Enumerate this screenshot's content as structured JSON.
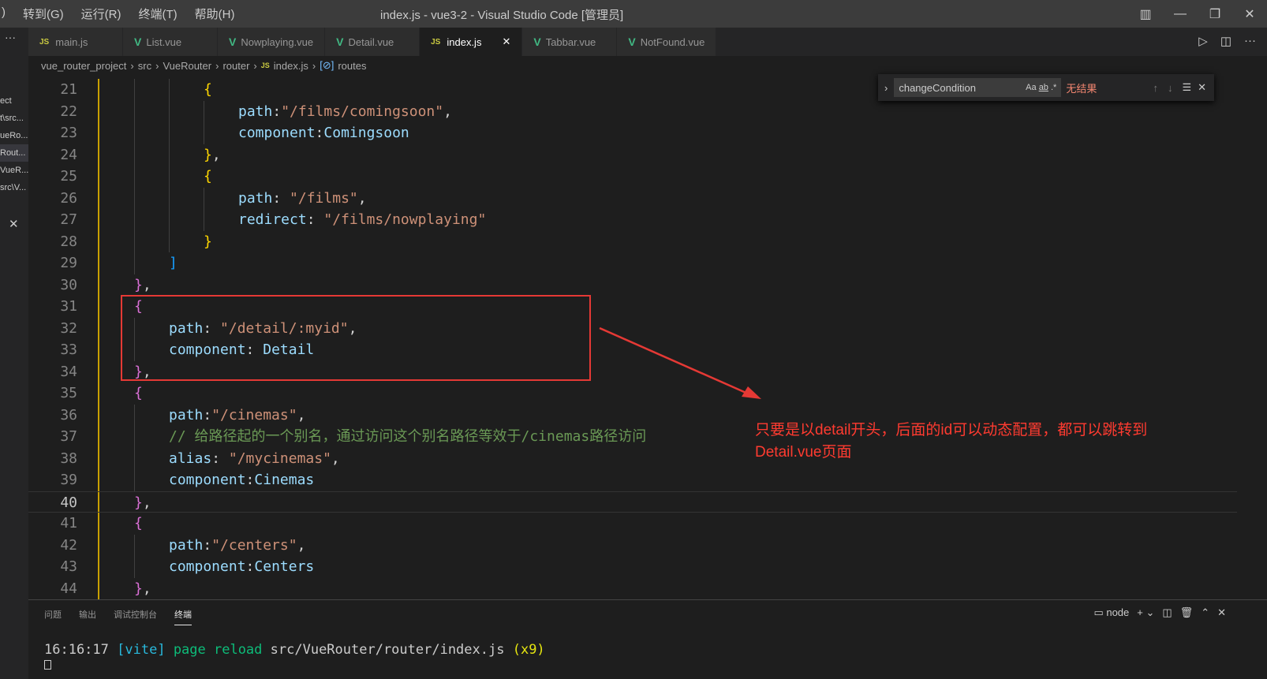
{
  "titlebar": {
    "menu": [
      ")",
      "转到(G)",
      "运行(R)",
      "终端(T)",
      "帮助(H)"
    ],
    "title": "index.js - vue3-2 - Visual Studio Code [管理员]"
  },
  "sidebar": {
    "items": [
      "ect",
      "t\\src...",
      "ueRo...",
      "Rout...",
      "VueR...",
      "src\\V..."
    ]
  },
  "tabs": [
    {
      "label": "main.js",
      "type": "js"
    },
    {
      "label": "List.vue",
      "type": "vue"
    },
    {
      "label": "Nowplaying.vue",
      "type": "vue"
    },
    {
      "label": "Detail.vue",
      "type": "vue"
    },
    {
      "label": "index.js",
      "type": "js",
      "active": true
    },
    {
      "label": "Tabbar.vue",
      "type": "vue"
    },
    {
      "label": "NotFound.vue",
      "type": "vue"
    }
  ],
  "breadcrumb": [
    "vue_router_project",
    "src",
    "VueRouter",
    "router",
    "index.js",
    "routes"
  ],
  "find": {
    "value": "changeCondition",
    "status": "无结果",
    "opts": [
      "Aa",
      "ab",
      ".*"
    ]
  },
  "code": [
    {
      "n": "21",
      "i": 12,
      "t": [
        [
          "b2",
          "{"
        ]
      ]
    },
    {
      "n": "22",
      "i": 16,
      "t": [
        [
          "k",
          "path"
        ],
        [
          "p",
          ":"
        ],
        [
          "s",
          "\"/films/comingsoon\""
        ],
        [
          "p",
          ","
        ]
      ]
    },
    {
      "n": "23",
      "i": 16,
      "t": [
        [
          "k",
          "component"
        ],
        [
          "p",
          ":"
        ],
        [
          "id",
          "Comingsoon"
        ]
      ]
    },
    {
      "n": "24",
      "i": 12,
      "t": [
        [
          "b2",
          "}"
        ],
        [
          "p",
          ","
        ]
      ]
    },
    {
      "n": "25",
      "i": 12,
      "t": [
        [
          "b2",
          "{"
        ]
      ]
    },
    {
      "n": "26",
      "i": 16,
      "t": [
        [
          "k",
          "path"
        ],
        [
          "p",
          ": "
        ],
        [
          "s",
          "\"/films\""
        ],
        [
          "p",
          ","
        ]
      ]
    },
    {
      "n": "27",
      "i": 16,
      "t": [
        [
          "k",
          "redirect"
        ],
        [
          "p",
          ": "
        ],
        [
          "s",
          "\"/films/nowplaying\""
        ]
      ]
    },
    {
      "n": "28",
      "i": 12,
      "t": [
        [
          "b2",
          "}"
        ]
      ]
    },
    {
      "n": "29",
      "i": 8,
      "t": [
        [
          "b3",
          "]"
        ]
      ]
    },
    {
      "n": "30",
      "i": 4,
      "t": [
        [
          "b1",
          "}"
        ],
        [
          "p",
          ","
        ]
      ]
    },
    {
      "n": "31",
      "i": 4,
      "t": [
        [
          "b1",
          "{"
        ]
      ]
    },
    {
      "n": "32",
      "i": 8,
      "t": [
        [
          "k",
          "path"
        ],
        [
          "p",
          ": "
        ],
        [
          "s",
          "\"/detail/:myid\""
        ],
        [
          "p",
          ","
        ]
      ]
    },
    {
      "n": "33",
      "i": 8,
      "t": [
        [
          "k",
          "component"
        ],
        [
          "p",
          ": "
        ],
        [
          "id",
          "Detail"
        ]
      ]
    },
    {
      "n": "34",
      "i": 4,
      "t": [
        [
          "b1",
          "}"
        ],
        [
          "p",
          ","
        ]
      ]
    },
    {
      "n": "35",
      "i": 4,
      "t": [
        [
          "b1",
          "{"
        ]
      ]
    },
    {
      "n": "36",
      "i": 8,
      "t": [
        [
          "k",
          "path"
        ],
        [
          "p",
          ":"
        ],
        [
          "s",
          "\"/cinemas\""
        ],
        [
          "p",
          ","
        ]
      ]
    },
    {
      "n": "37",
      "i": 8,
      "t": [
        [
          "c",
          "// 给路径起的一个别名，通过访问这个别名路径等效于/cinemas路径访问"
        ]
      ]
    },
    {
      "n": "38",
      "i": 8,
      "t": [
        [
          "k",
          "alias"
        ],
        [
          "p",
          ": "
        ],
        [
          "s",
          "\"/mycinemas\""
        ],
        [
          "p",
          ","
        ]
      ]
    },
    {
      "n": "39",
      "i": 8,
      "t": [
        [
          "k",
          "component"
        ],
        [
          "p",
          ":"
        ],
        [
          "id",
          "Cinemas"
        ]
      ]
    },
    {
      "n": "40",
      "i": 4,
      "t": [
        [
          "b1",
          "}"
        ],
        [
          "p",
          ","
        ]
      ],
      "current": true
    },
    {
      "n": "41",
      "i": 4,
      "t": [
        [
          "b1",
          "{"
        ]
      ]
    },
    {
      "n": "42",
      "i": 8,
      "t": [
        [
          "k",
          "path"
        ],
        [
          "p",
          ":"
        ],
        [
          "s",
          "\"/centers\""
        ],
        [
          "p",
          ","
        ]
      ]
    },
    {
      "n": "43",
      "i": 8,
      "t": [
        [
          "k",
          "component"
        ],
        [
          "p",
          ":"
        ],
        [
          "id",
          "Centers"
        ]
      ]
    },
    {
      "n": "44",
      "i": 4,
      "t": [
        [
          "b1",
          "}"
        ],
        [
          "p",
          ","
        ]
      ]
    }
  ],
  "annotation": {
    "text": "只要是以detail开头，后面的id可以动态配置，都可以跳转到Detail.vue页面",
    "color": "#ff3b30"
  },
  "panel": {
    "tabs": [
      "问题",
      "输出",
      "调试控制台",
      "终端"
    ],
    "active": "终端",
    "terminal_name": "node",
    "terminal": {
      "time": "16:16:17",
      "tag": "[vite]",
      "msg": "page reload",
      "file": "src/VueRouter/router/index.js",
      "count": "(x9)"
    }
  }
}
